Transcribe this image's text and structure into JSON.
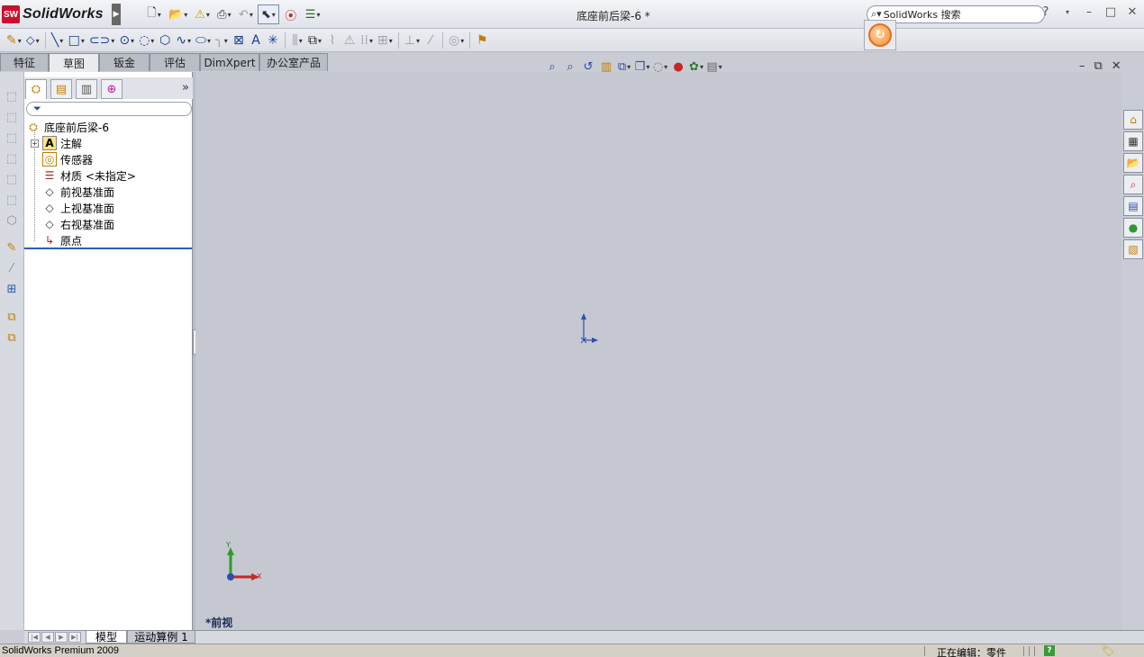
{
  "app": {
    "logo_badge": "SW",
    "logo_name": "SolidWorks",
    "document_title": "底座前后梁-6 *",
    "search_placeholder": "SolidWorks 搜索",
    "help_label": "?"
  },
  "window_controls": {
    "minimize": "–",
    "maximize": "□",
    "close": "✕"
  },
  "title_toolbar": [
    {
      "name": "new-document",
      "glyph": "🗋"
    },
    {
      "name": "open",
      "glyph": "📂"
    },
    {
      "name": "rebuild",
      "glyph": "⚠"
    },
    {
      "name": "print",
      "glyph": "⎙"
    },
    {
      "name": "undo",
      "glyph": "↶"
    },
    {
      "name": "select",
      "glyph": "⬉"
    },
    {
      "name": "traffic-light",
      "glyph": "⦿"
    },
    {
      "name": "options",
      "glyph": "☰"
    }
  ],
  "sketch_toolbar": [
    {
      "name": "smart-dimension",
      "glyph": "✎"
    },
    {
      "name": "line",
      "glyph": "╲"
    },
    {
      "name": "rectangle",
      "glyph": "□"
    },
    {
      "name": "slot",
      "glyph": "⊂⊃"
    },
    {
      "name": "circle",
      "glyph": "⊙"
    },
    {
      "name": "arc",
      "glyph": "◌"
    },
    {
      "name": "polygon",
      "glyph": "⬡"
    },
    {
      "name": "spline",
      "glyph": "∿"
    },
    {
      "name": "ellipse",
      "glyph": "⬭"
    },
    {
      "name": "fillet",
      "glyph": "╮"
    },
    {
      "name": "sketch-point",
      "glyph": "⋯"
    },
    {
      "name": "text",
      "glyph": "A"
    },
    {
      "name": "point",
      "glyph": "✳"
    },
    {
      "name": "mirror",
      "glyph": "⫼"
    },
    {
      "name": "offset",
      "glyph": "⧉"
    },
    {
      "name": "trim",
      "glyph": "⌇"
    },
    {
      "name": "convert",
      "glyph": "⚠"
    },
    {
      "name": "linear-pattern",
      "glyph": "⁞⁞"
    },
    {
      "name": "move",
      "glyph": "⊞"
    },
    {
      "name": "relations",
      "glyph": "⊥"
    },
    {
      "name": "quick-snaps",
      "glyph": "⁄"
    },
    {
      "name": "rapid-sketch",
      "glyph": "◎"
    },
    {
      "name": "repair-sketch",
      "glyph": "⚑"
    }
  ],
  "command_tabs": [
    {
      "label": "特征",
      "active": false
    },
    {
      "label": "草图",
      "active": true
    },
    {
      "label": "钣金",
      "active": false
    },
    {
      "label": "评估",
      "active": false
    },
    {
      "label": "DimXpert",
      "active": false
    },
    {
      "label": "办公室产品",
      "active": false
    }
  ],
  "feature_tree": {
    "panel_tabs": [
      "FeatureManager",
      "PropertyManager",
      "ConfigurationManager",
      "DimXpertManager"
    ],
    "more_label": "»",
    "root": "底座前后梁-6",
    "items": [
      {
        "label": "注解",
        "icon": "A",
        "expandable": true
      },
      {
        "label": "传感器",
        "icon": "◎",
        "expandable": false
      },
      {
        "label": "材质 <未指定>",
        "icon": "☰",
        "expandable": false
      },
      {
        "label": "前视基准面",
        "icon": "◇",
        "expandable": false
      },
      {
        "label": "上视基准面",
        "icon": "◇",
        "expandable": false
      },
      {
        "label": "右视基准面",
        "icon": "◇",
        "expandable": false
      },
      {
        "label": "原点",
        "icon": "↳",
        "expandable": false
      }
    ]
  },
  "heads_up_toolbar": [
    "zoom-to-fit",
    "zoom-to-area",
    "previous-view",
    "section-view",
    "view-orientation",
    "display-style",
    "hide-show-items",
    "edit-appearance",
    "apply-scene",
    "view-settings"
  ],
  "graphics": {
    "view_label": "*前视",
    "triad": {
      "y_label": "Y",
      "x_label": "X"
    }
  },
  "task_pane": [
    "resources",
    "design-library",
    "file-explorer",
    "search",
    "view-palette",
    "appearances",
    "custom-properties"
  ],
  "bottom_tabs": [
    {
      "label": "模型",
      "active": true
    },
    {
      "label": "运动算例 1",
      "active": false
    }
  ],
  "status": {
    "product": "SolidWorks Premium 2009",
    "editing": "正在编辑：零件"
  },
  "colors": {
    "viewport_bg": "#c5c8d0",
    "accent_blue": "#2d5dbf",
    "logo_red": "#c8102e"
  }
}
